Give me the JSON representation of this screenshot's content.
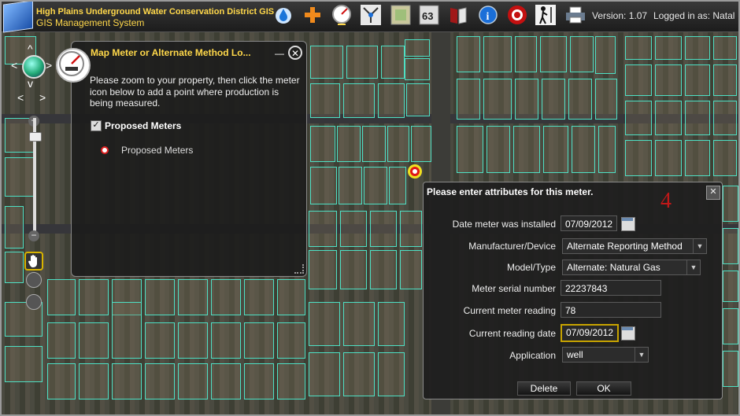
{
  "header": {
    "title_line1": "High Plains Underground Water Conservation District GIS",
    "title_line2": "GIS Management System",
    "version": "Version: 1.07",
    "logged_in": "Logged in as: Natal",
    "toolbar_icons": [
      "water-drop-icon",
      "plus-icon",
      "meter-gauge-icon",
      "network-icon",
      "map-layer-icon",
      "numbered-map-icon",
      "book-icon",
      "info-icon",
      "target-icon",
      "person-measure-icon",
      "printer-icon"
    ]
  },
  "meter_panel": {
    "title": "Map Meter or Alternate Method Lo...",
    "instruction": "Please zoom to your property, then click the meter icon below to add a point where production is being measured.",
    "layer_label": "Proposed Meters",
    "legend_label": "Proposed Meters",
    "min_symbol": "—",
    "close_symbol": "✕"
  },
  "attr_dialog": {
    "title": "Please enter attributes for this meter.",
    "step_number": "4",
    "close_symbol": "✕",
    "fields": {
      "date_installed": {
        "label": "Date meter was installed",
        "value": "07/09/2012"
      },
      "manufacturer": {
        "label": "Manufacturer/Device",
        "value": "Alternate Reporting Method"
      },
      "model": {
        "label": "Model/Type",
        "value": "Alternate: Natural Gas"
      },
      "serial": {
        "label": "Meter serial number",
        "value": "22237843"
      },
      "reading": {
        "label": "Current meter reading",
        "value": "78"
      },
      "reading_date": {
        "label": "Current reading date",
        "value": "07/09/2012"
      },
      "application": {
        "label": "Application",
        "value": "well"
      }
    },
    "delete_label": "Delete",
    "ok_label": "OK"
  },
  "colors": {
    "accent": "#ffd84a",
    "parcel": "#4ee0c4",
    "marker": "#e01818",
    "step": "#c01818"
  }
}
